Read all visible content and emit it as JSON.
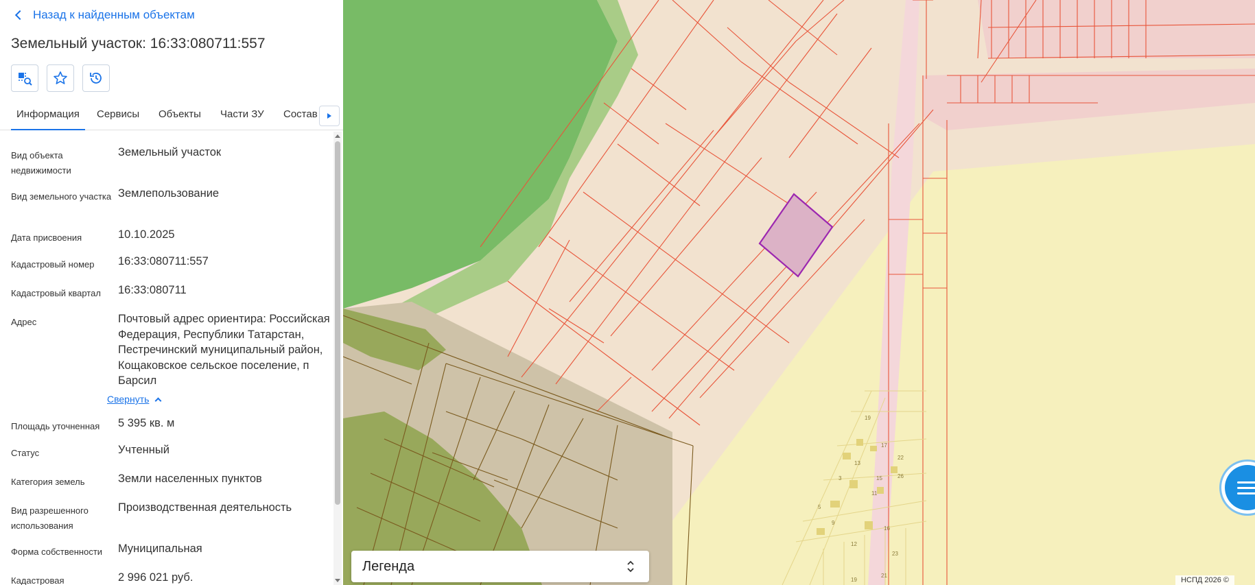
{
  "sidebar": {
    "back_label": "Назад к найденным объектам",
    "title": "Земельный участок: 16:33:080711:557",
    "tabs": [
      "Информация",
      "Сервисы",
      "Объекты",
      "Части ЗУ",
      "Состав"
    ],
    "fields": [
      {
        "label": "Вид объекта недвижимости",
        "value": "Земельный участок"
      },
      {
        "label": "Вид земельного участка",
        "value": "Землепользование"
      },
      {
        "label": "Дата присвоения",
        "value": "10.10.2025"
      },
      {
        "label": "Кадастровый номер",
        "value": "16:33:080711:557"
      },
      {
        "label": "Кадастровый квартал",
        "value": "16:33:080711"
      },
      {
        "label": "Адрес",
        "value": "Почтовый адрес ориентира: Российская Федерация, Республики Татарстан, Пестречинский муниципальный район, Кощаковское сельское поселение, п Барсил"
      },
      {
        "label": "Площадь уточненная",
        "value": "5 395 кв. м"
      },
      {
        "label": "Статус",
        "value": "Учтенный"
      },
      {
        "label": "Категория земель",
        "value": "Земли населенных пунктов"
      },
      {
        "label": "Вид разрешенного использования",
        "value": "Производственная деятельность"
      },
      {
        "label": "Форма собственности",
        "value": "Муниципальная"
      },
      {
        "label": "Кадастровая",
        "value": "2 996 021 руб."
      }
    ],
    "collapse_label": "Свернуть"
  },
  "map": {
    "legend_label": "Легенда",
    "copyright": "НСПД 2026 ©",
    "building_numbers": [
      "19",
      "17",
      "13",
      "22",
      "26",
      "15",
      "11",
      "16",
      "12",
      "23",
      "21",
      "9",
      "5",
      "3",
      "19"
    ]
  },
  "colors": {
    "accent": "#1a73e8",
    "parcel_border": "#e8553a",
    "selected_parcel": "#9c27b0",
    "forest": "#78bb66"
  },
  "icons": [
    "chevron-left-icon",
    "map-search-icon",
    "star-icon",
    "history-icon",
    "chevron-right-icon",
    "chevron-up-icon",
    "chevron-updown-icon",
    "chat-icon"
  ]
}
